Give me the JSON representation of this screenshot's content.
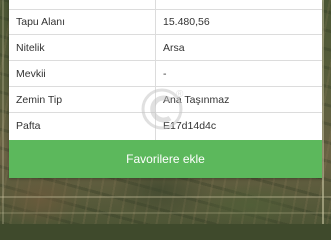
{
  "details": {
    "rows": [
      {
        "label": "",
        "value": ""
      },
      {
        "label": "Tapu Alanı",
        "value": "15.480,56"
      },
      {
        "label": "Nitelik",
        "value": "Arsa"
      },
      {
        "label": "Mevkii",
        "value": "-"
      },
      {
        "label": "Zemin Tip",
        "value": "Ana Taşınmaz"
      },
      {
        "label": "Pafta",
        "value": "E17d14d4c"
      }
    ]
  },
  "actions": {
    "favorite_label": "Favorilere ekle"
  },
  "colors": {
    "button_green": "#5cb85c",
    "panel_bg": "#ffffff",
    "border": "#dcdcdc"
  },
  "icons": {
    "watermark": "copyright-logo-watermark"
  }
}
